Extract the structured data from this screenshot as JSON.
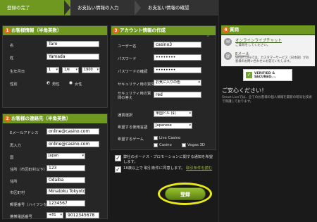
{
  "steps": [
    "登録の完了",
    "お支払い情報の入力",
    "お支払い情報の確認"
  ],
  "personal": {
    "number": "1",
    "title": "お客様情報（半角英数）",
    "labels": [
      "名",
      "姓",
      "生年月日",
      "性別"
    ],
    "first_name": "Taro",
    "last_name": "Yamada",
    "dob_day": "1",
    "dob_month": "1月",
    "dob_year": "1900",
    "gender_male": "男性",
    "gender_female": "女性"
  },
  "contact": {
    "number": "2",
    "title": "お客様の連絡先（半角英数）",
    "labels": [
      "Eメールアドレス",
      "再入力",
      "国",
      "住所（市区町村以下）",
      "住所",
      "市区町村",
      "郵便番号（ハイフンなし）",
      "携帯電話番号"
    ],
    "email": "online@casino.com",
    "email_confirm": "online@casino.com",
    "country": "Japan",
    "address1": "123",
    "address2": "Odaiba",
    "city": "Minatoku Tokyoto",
    "postcode": "1234567",
    "phone_code": "+81",
    "phone": "9012345678"
  },
  "account": {
    "number": "3",
    "title": "アカウント情報の作成",
    "labels": [
      "ユーザー名",
      "パスワード",
      "パスワードの確認",
      "セキュリティ用の質問",
      "セキュリティ用の質問の答え",
      "通貨選択",
      "希望する使用言語",
      "希望するゲーム"
    ],
    "username": "casino3",
    "password": "••••••••",
    "password_confirm": "••••••••",
    "security_question": "お気に入りの色",
    "security_answer": "red",
    "currency": "米国ドル ($)",
    "language": "Japanese",
    "games": [
      "Live Casino",
      "Casino",
      "Vegas 3D"
    ]
  },
  "agreements": {
    "promo": "弊社のボーナス・プロモーションに関する通知を希望します。",
    "terms": "18歳以上で 取引条件に同意します。",
    "terms_link": "取引条件を読む"
  },
  "register_label": "登録",
  "help": {
    "number": "4",
    "title": "質問",
    "live_chat_title": "オンラインライブチャット",
    "live_chat_sub": "ご質問をしてください。",
    "email_title": "Eメール",
    "email_sub": "Smart Liveでは、カスタマーサービス（日本語）がお客様のお問い合わせにお答えいたします。",
    "verified_label": "VERIFIED & SECURED",
    "secure_title": "ご安心ください！",
    "secure_text": "Smart Liveでは、全てのお客様の個人情報を最新の暗号化技術で保護しております。",
    "verified_sub": "VERIFY SECURITY"
  }
}
